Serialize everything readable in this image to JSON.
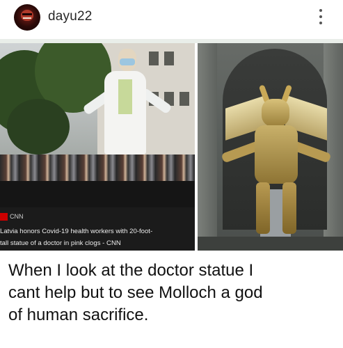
{
  "post_header": {
    "username": "dayu22",
    "avatar_icon": "avatar-icon",
    "menu_icon": "more-vertical-icon"
  },
  "left_image": {
    "source_label": "CNN",
    "headline": "Latvia honors Covid-19 health workers with 20-foot-tall statue of a doctor in pink clogs - CNN",
    "headline_line1": "Latvia honors Covid-19 health workers with 20-foot-",
    "headline_line2": "tall statue of a doctor in pink clogs - CNN",
    "logo_color": "#cc0000"
  },
  "meme_caption": {
    "line1": "When I look at the doctor statue I",
    "line2": "cant help but to see Molloch a god",
    "line3": "of human sacrifice."
  },
  "colors": {
    "text_primary": "#111111",
    "username": "#262626",
    "divider": "#e9eee9"
  }
}
